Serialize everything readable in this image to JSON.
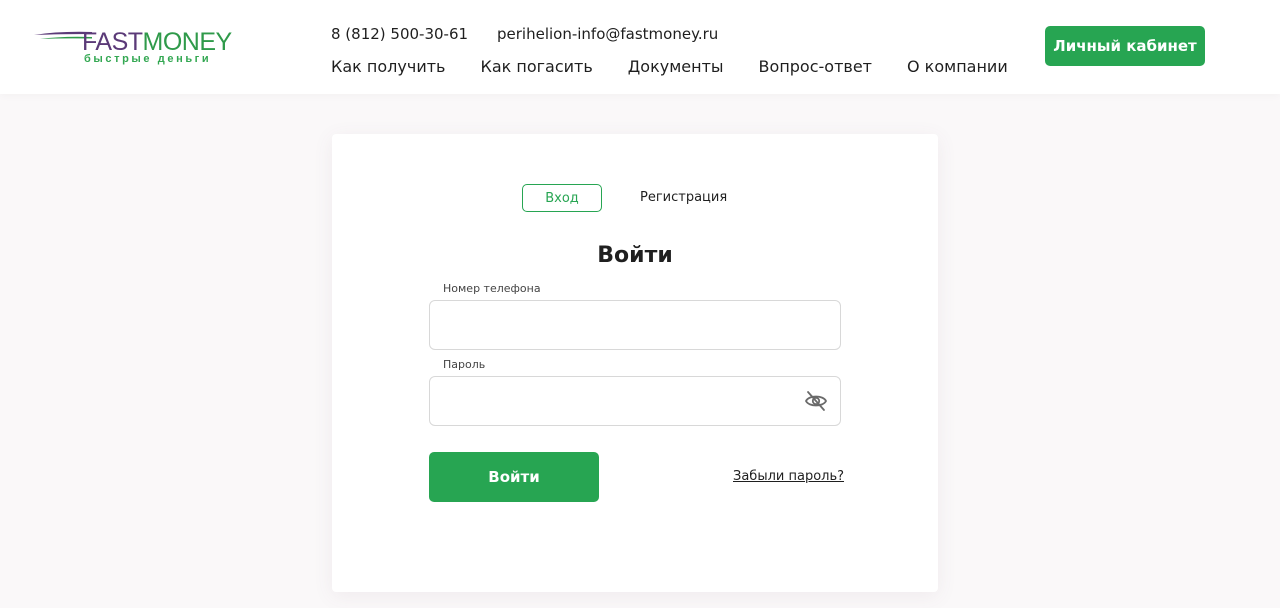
{
  "header": {
    "logo": {
      "fast": "FAST",
      "money": "MONEY",
      "subtitle": "быстрые деньги",
      "colors": {
        "fast": "#5b3a78",
        "money": "#2f9a4a"
      }
    },
    "phone": "8 (812) 500-30-61",
    "email": "perihelion-info@fastmoney.ru",
    "nav": [
      {
        "label": "Как получить"
      },
      {
        "label": "Как погасить"
      },
      {
        "label": "Документы"
      },
      {
        "label": "Вопрос-ответ"
      },
      {
        "label": "О компании"
      }
    ],
    "cabinet_label": "Личный кабинет"
  },
  "auth": {
    "tabs": {
      "login": "Вход",
      "register": "Регистрация"
    },
    "title": "Войти",
    "phone": {
      "label": "Номер телефона",
      "value": "",
      "placeholder": ""
    },
    "password": {
      "label": "Пароль",
      "value": "",
      "placeholder": "",
      "toggle_icon": "eye-slash-icon"
    },
    "submit_label": "Войти",
    "forgot_label": "Забыли пароль?"
  },
  "colors": {
    "accent": "#27a552",
    "text": "#1f1f1f",
    "background": "#faf8f9"
  }
}
